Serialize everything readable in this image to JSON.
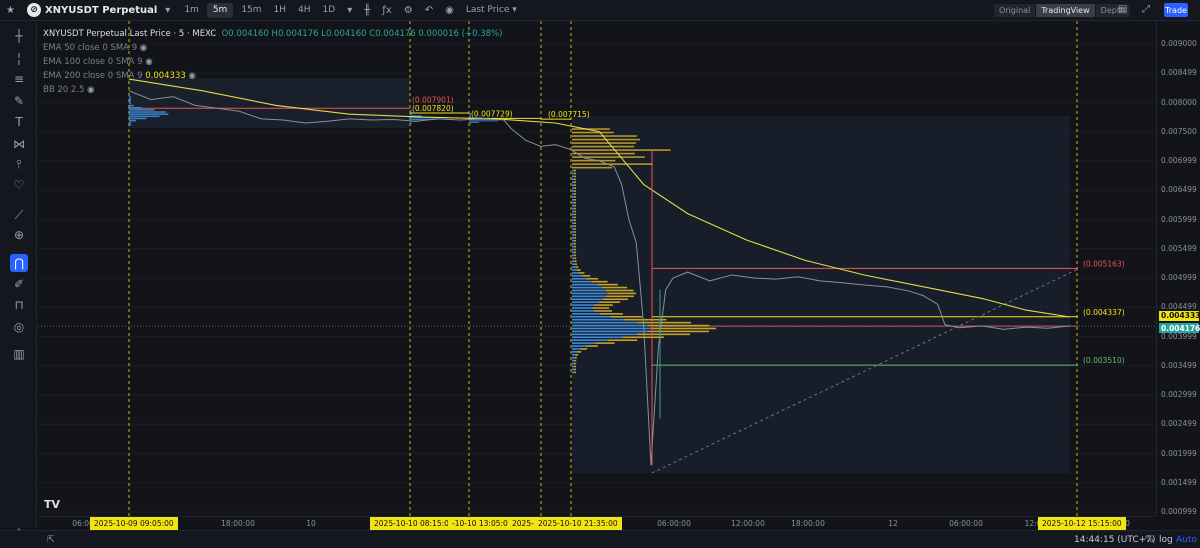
{
  "toolbar": {
    "symbol": "XNYUSDT Perpetual",
    "intervals": [
      "1m",
      "5m",
      "15m",
      "1H",
      "4H",
      "1D"
    ],
    "active_interval": "5m",
    "price_type": "Last Price",
    "view_tabs": [
      "Original",
      "TradingView",
      "Depth"
    ],
    "active_view": "TradingView",
    "trade_label": "Trade"
  },
  "legend": {
    "title": "XNYUSDT Perpetual Last Price · 5 · MEXC",
    "ohlc": "O0.004160 H0.004176 L0.004160 C0.004176 0.000016 (+0.38%)",
    "indicators": [
      {
        "label": "EMA 50 close 0 SMA 9",
        "value": ""
      },
      {
        "label": "EMA 100 close 0 SMA 9",
        "value": ""
      },
      {
        "label": "EMA 200 close 0 SMA 9",
        "value": "0.004333"
      },
      {
        "label": "BB 20 2.5",
        "value": ""
      }
    ]
  },
  "chart_data": {
    "type": "line",
    "title": "XNYUSDT Perpetual Last Price · 5 · MEXC",
    "price_ticks": [
      "0.009000",
      "0.008499",
      "0.008000",
      "0.007500",
      "0.006999",
      "0.006499",
      "0.005999",
      "0.005499",
      "0.004999",
      "0.004499",
      "0.003999",
      "0.003499",
      "0.002999",
      "0.002499",
      "0.001999",
      "0.001499",
      "0.000999"
    ],
    "time_ticks": [
      "06:00",
      "18:00:00",
      "10",
      "06:00:00",
      "12:00:00",
      "18:00:00",
      "12",
      "06:00:00",
      "12:0",
      "18:00:00"
    ],
    "time_markers": [
      "2025-10-09  09:05:00",
      "2025-10-10  08:15:00",
      "-10-10  13:05:00",
      "2025-10-",
      "2025-10-10  21:35:00",
      "2025-10-12  15:15:00"
    ],
    "level_labels": [
      {
        "text": "(0.007901)",
        "color": "#ef5350"
      },
      {
        "text": "(0.007820)",
        "color": "#f2e411"
      },
      {
        "text": "(0.007729)",
        "color": "#f2e411"
      },
      {
        "text": "(0.007715)",
        "color": "#f2e411"
      },
      {
        "text": "(0.005163)",
        "color": "#ef5350"
      },
      {
        "text": "(0.004337)",
        "color": "#f2e411"
      },
      {
        "text": "(0.003510)",
        "color": "#66bb6a"
      }
    ],
    "price_tags": [
      {
        "text": "0.004333",
        "color": "#f2e411"
      },
      {
        "text": "0.004176",
        "color": "#26a69a"
      }
    ],
    "price_series": [
      [
        0,
        0.0082
      ],
      [
        3,
        0.00805
      ],
      [
        6,
        0.0081
      ],
      [
        9,
        0.00795
      ],
      [
        12,
        0.0079
      ],
      [
        15,
        0.00785
      ],
      [
        18,
        0.00772
      ],
      [
        21,
        0.0077
      ],
      [
        24,
        0.00765
      ],
      [
        27,
        0.00768
      ],
      [
        30,
        0.00772
      ],
      [
        33,
        0.0077
      ],
      [
        36,
        0.00771
      ],
      [
        39,
        0.00768
      ],
      [
        42,
        0.00772
      ],
      [
        45,
        0.0077
      ],
      [
        48,
        0.00772
      ],
      [
        51,
        0.0077
      ],
      [
        52,
        0.00755
      ],
      [
        54,
        0.00735
      ],
      [
        56,
        0.00725
      ],
      [
        58,
        0.00728
      ],
      [
        60,
        0.0072
      ],
      [
        62,
        0.00705
      ],
      [
        64,
        0.007
      ],
      [
        66,
        0.0069
      ],
      [
        67,
        0.0066
      ],
      [
        68,
        0.006
      ],
      [
        69,
        0.0056
      ],
      [
        70,
        0.0042
      ],
      [
        71,
        0.0018
      ],
      [
        72,
        0.0038
      ],
      [
        73,
        0.0048
      ],
      [
        74,
        0.005
      ],
      [
        76,
        0.0051
      ],
      [
        79,
        0.00495
      ],
      [
        82,
        0.00505
      ],
      [
        85,
        0.005
      ],
      [
        88,
        0.00498
      ],
      [
        91,
        0.00502
      ],
      [
        94,
        0.00495
      ],
      [
        97,
        0.00492
      ],
      [
        100,
        0.00488
      ],
      [
        103,
        0.00485
      ],
      [
        106,
        0.00478
      ],
      [
        108,
        0.0047
      ],
      [
        110,
        0.00455
      ],
      [
        111,
        0.0042
      ],
      [
        113,
        0.00415
      ],
      [
        116,
        0.00418
      ],
      [
        119,
        0.00412
      ],
      [
        122,
        0.00416
      ],
      [
        125,
        0.00414
      ],
      [
        128,
        0.00418
      ]
    ],
    "ema_series": [
      [
        0,
        0.0084
      ],
      [
        10,
        0.0082
      ],
      [
        20,
        0.00795
      ],
      [
        30,
        0.0078
      ],
      [
        40,
        0.00775
      ],
      [
        50,
        0.00772
      ],
      [
        58,
        0.00765
      ],
      [
        64,
        0.0075
      ],
      [
        66,
        0.0072
      ],
      [
        70,
        0.0066
      ],
      [
        76,
        0.0061
      ],
      [
        84,
        0.00565
      ],
      [
        92,
        0.0053
      ],
      [
        100,
        0.00505
      ],
      [
        108,
        0.00485
      ],
      [
        116,
        0.00465
      ],
      [
        122,
        0.00445
      ],
      [
        128,
        0.004333
      ]
    ],
    "ylim": [
      0.000999,
      0.009
    ]
  },
  "status": {
    "time": "14:44:15 (UTC+7)",
    "percent": "%",
    "log": "log",
    "auto": "Auto"
  }
}
